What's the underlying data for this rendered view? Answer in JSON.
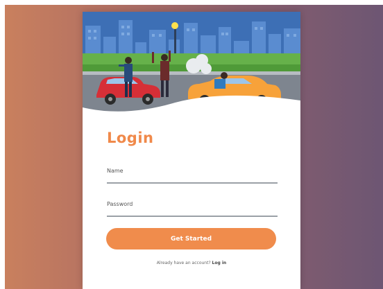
{
  "form": {
    "title": "Login",
    "name_label": "Name",
    "password_label": "Password",
    "cta_label": "Get Started",
    "footer_text": "Already have an account? ",
    "footer_link": "Log in"
  },
  "colors": {
    "accent": "#f08c4c",
    "background_left": "#c9805e",
    "background_right": "#6d5673",
    "input_underline": "#9aa0a6"
  },
  "illustration": {
    "scene": "city-street-car-accident",
    "icons": [
      "city-skyline",
      "street-lamp-icon",
      "red-car-icon",
      "orange-car-icon",
      "smoke-cloud-icon"
    ]
  }
}
